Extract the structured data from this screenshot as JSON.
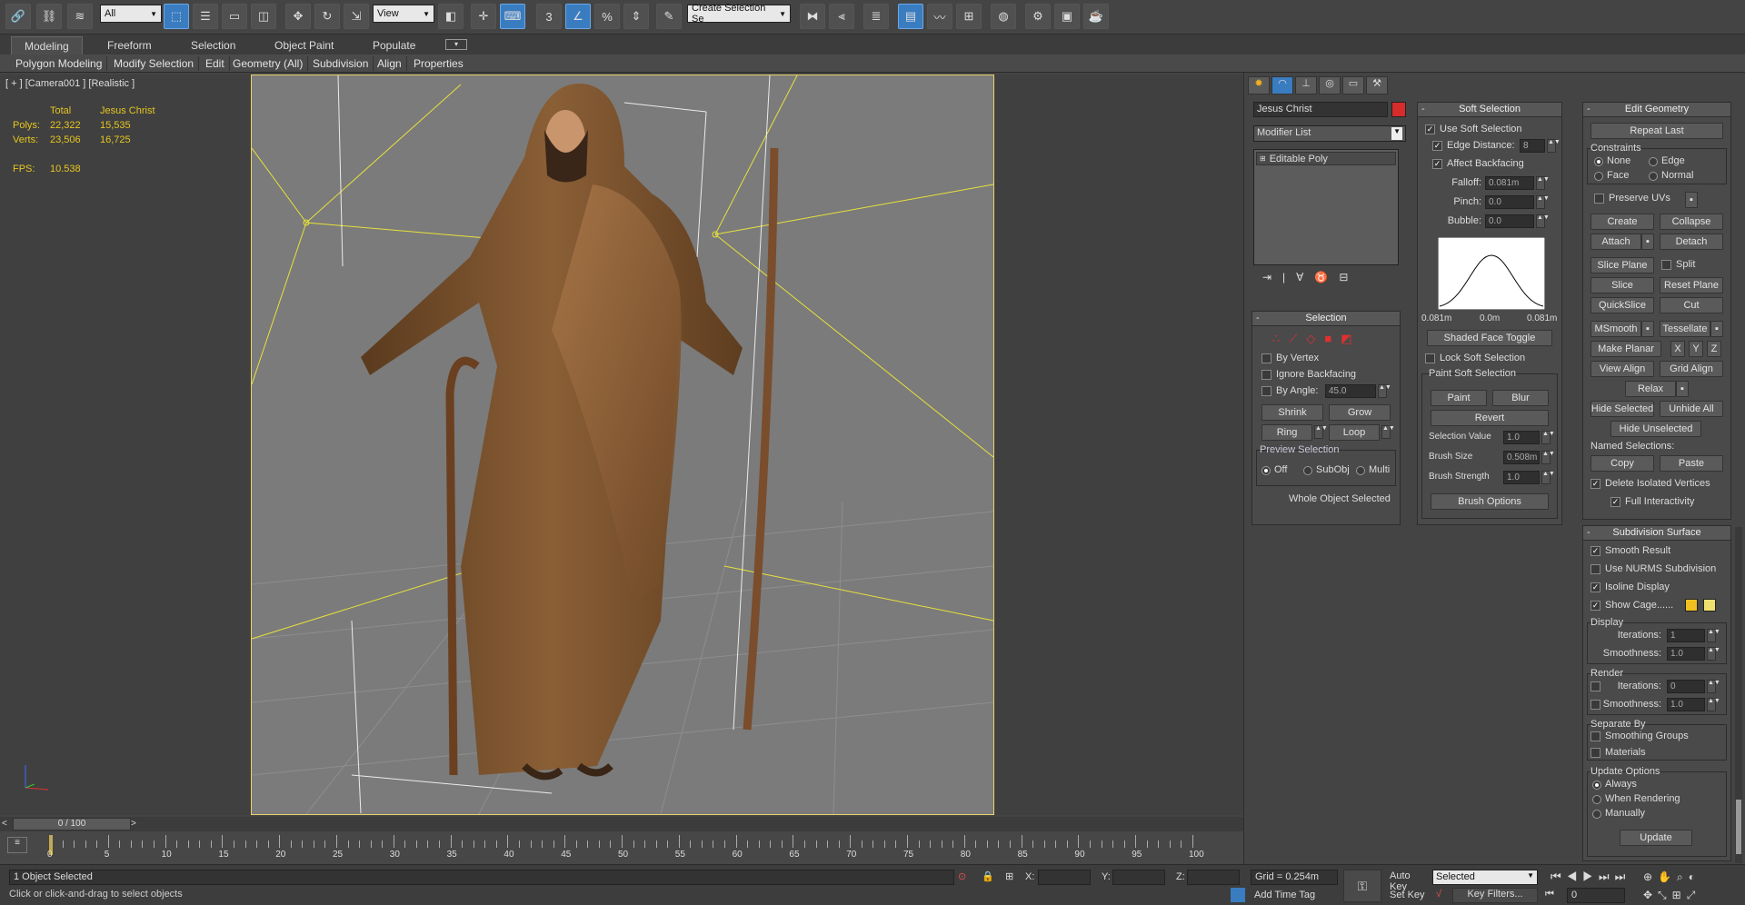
{
  "toolbar": {
    "filter_value": "All",
    "refcoord_value": "View",
    "create_selection_set": "Create Selection Se",
    "snap_label": "3",
    "angle_snap_label": "%"
  },
  "ribbon": {
    "tabs": [
      "Modeling",
      "Freeform",
      "Selection",
      "Object Paint",
      "Populate"
    ],
    "sub": [
      "Polygon Modeling",
      "Modify Selection",
      "Edit",
      "Geometry (All)",
      "Subdivision",
      "Align",
      "Properties"
    ]
  },
  "viewport": {
    "label": "[ + ] [Camera001 ] [Realistic ]",
    "stats": {
      "header_total": "Total",
      "header_object": "Jesus Christ",
      "polys_label": "Polys:",
      "polys_total": "22,322",
      "polys_obj": "15,535",
      "verts_label": "Verts:",
      "verts_total": "23,506",
      "verts_obj": "16,725",
      "fps_label": "FPS:",
      "fps_value": "10.538"
    }
  },
  "timeline": {
    "frame_display": "0 / 100",
    "ticks": [
      "0",
      "5",
      "10",
      "15",
      "20",
      "25",
      "30",
      "35",
      "40",
      "45",
      "50",
      "55",
      "60",
      "65",
      "70",
      "75",
      "80",
      "85",
      "90",
      "95",
      "100"
    ]
  },
  "status": {
    "selected": "1 Object Selected",
    "prompt": "Click or click-and-drag to select objects",
    "x_label": "X:",
    "y_label": "Y:",
    "z_label": "Z:",
    "grid": "Grid = 0.254m",
    "add_time_tag": "Add Time Tag",
    "auto_key": "Auto Key",
    "set_key": "Set Key",
    "key_mode": "Selected",
    "key_filters": "Key Filters...",
    "current_frame": "0"
  },
  "modify": {
    "object_name": "Jesus Christ",
    "object_color": "#d82b2b",
    "modifier_list": "Modifier List",
    "stack_item": "Editable Poly"
  },
  "selection": {
    "title": "Selection",
    "by_vertex": "By Vertex",
    "ignore_backfacing": "Ignore Backfacing",
    "by_angle": "By Angle:",
    "angle_value": "45.0",
    "shrink": "Shrink",
    "grow": "Grow",
    "ring": "Ring",
    "loop": "Loop",
    "preview_title": "Preview Selection",
    "off": "Off",
    "subobj": "SubObj",
    "multi": "Multi",
    "whole": "Whole Object Selected"
  },
  "soft": {
    "title": "Soft Selection",
    "use_soft": "Use Soft Selection",
    "edge_distance": "Edge Distance:",
    "edge_value": "8",
    "affect_backfacing": "Affect Backfacing",
    "falloff": "Falloff:",
    "falloff_value": "0.081m",
    "pinch": "Pinch:",
    "pinch_value": "0.0",
    "bubble": "Bubble:",
    "bubble_value": "0.0",
    "curve_left": "0.081m",
    "curve_mid": "0.0m",
    "curve_right": "0.081m",
    "shaded": "Shaded Face Toggle",
    "lock": "Lock Soft Selection",
    "paint_title": "Paint Soft Selection",
    "paint": "Paint",
    "blur": "Blur",
    "revert": "Revert",
    "sel_value": "Selection Value",
    "sel_value_v": "1.0",
    "brush_size": "Brush Size",
    "brush_size_v": "0.508m",
    "brush_strength": "Brush Strength",
    "brush_strength_v": "1.0",
    "brush_options": "Brush Options"
  },
  "edit": {
    "title": "Edit Geometry",
    "repeat_last": "Repeat Last",
    "constraints": "Constraints",
    "none": "None",
    "edge": "Edge",
    "face": "Face",
    "normal": "Normal",
    "preserve_uvs": "Preserve UVs",
    "create": "Create",
    "collapse": "Collapse",
    "attach": "Attach",
    "detach": "Detach",
    "slice_plane": "Slice Plane",
    "split": "Split",
    "slice": "Slice",
    "reset_plane": "Reset Plane",
    "quickslice": "QuickSlice",
    "cut": "Cut",
    "msmooth": "MSmooth",
    "tessellate": "Tessellate",
    "make_planar": "Make Planar",
    "x": "X",
    "y": "Y",
    "z": "Z",
    "view_align": "View Align",
    "grid_align": "Grid Align",
    "relax": "Relax",
    "hide_selected": "Hide Selected",
    "unhide_all": "Unhide All",
    "hide_unselected": "Hide Unselected",
    "named_selections": "Named Selections:",
    "copy": "Copy",
    "paste": "Paste",
    "delete_isolated": "Delete Isolated Vertices",
    "full_interactivity": "Full Interactivity"
  },
  "subdiv": {
    "title": "Subdivision Surface",
    "smooth_result": "Smooth Result",
    "use_nurms": "Use NURMS Subdivision",
    "isoline": "Isoline Display",
    "show_cage": "Show Cage......",
    "cage_color1": "#f0c020",
    "cage_color2": "#f0e070",
    "display": "Display",
    "iterations": "Iterations:",
    "iter_display_v": "1",
    "smoothness": "Smoothness:",
    "smooth_display_v": "1.0",
    "render": "Render",
    "iter_render_v": "0",
    "smooth_render_v": "1.0",
    "separate_by": "Separate By",
    "smoothing_groups": "Smoothing Groups",
    "materials": "Materials",
    "update_options": "Update Options",
    "always": "Always",
    "when_rendering": "When Rendering",
    "manually": "Manually",
    "update": "Update"
  }
}
